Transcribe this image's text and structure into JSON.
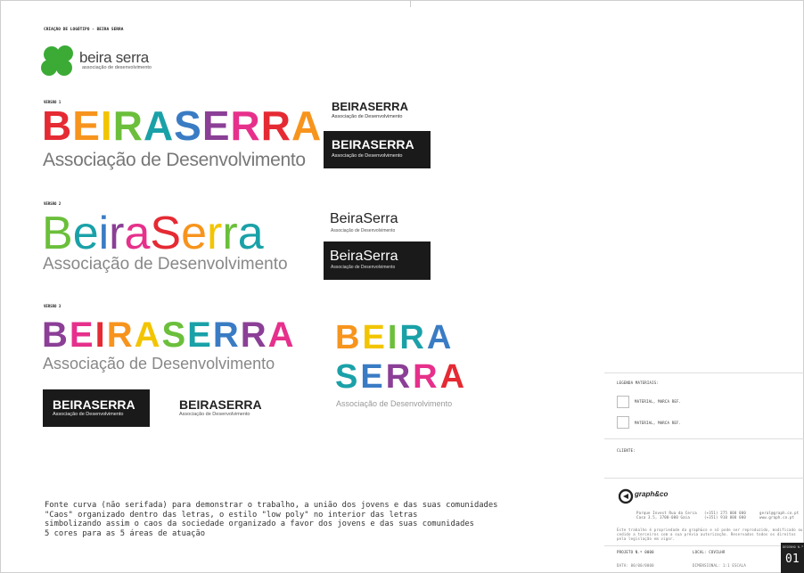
{
  "header": {
    "title": "CRIAÇÃO DE LOGÓTIPO - BEIRA SERRA",
    "logo_name": "beira serra",
    "logo_subtitle": "associação de desenvolvimento",
    "clover_color": "#3bab36"
  },
  "palette": [
    "#e52a33",
    "#f7941d",
    "#f2c500",
    "#6bbf3b",
    "#1aa1a8",
    "#3a7cc4",
    "#8b3f96",
    "#e6308b"
  ],
  "version1": {
    "label": "VERSÃO 1",
    "wordmark": "BEIRASERRA",
    "subtitle": "Associação de Desenvolvimento",
    "mini_wordmark": "BEIRASERRA",
    "mini_subtitle": "Associação de Desenvolvimento",
    "dark_wordmark": "BEIRASERRA",
    "dark_subtitle": "Associação de Desenvolvimento"
  },
  "version2": {
    "label": "VERSÃO 2",
    "wordmark": "BeiraSerra",
    "subtitle": "Associação de Desenvolvimento",
    "mini_wordmark": "BeiraSerra",
    "mini_subtitle": "Associação de Desenvolvimento",
    "dark_wordmark": "BeiraSerra",
    "dark_subtitle": "Associação de Desenvolvimento"
  },
  "version3": {
    "label": "VERSÃO 3",
    "wordmark": "BEIRASERRA",
    "subtitle": "Associação de Desenvolvimento",
    "dark_wordmark": "BEIRASERRA",
    "dark_subtitle": "Associação de Desenvolvimento",
    "mini_wordmark": "BEIRASERRA",
    "mini_subtitle": "Associação de Desenvolvimento",
    "stacked_line1": "BEIRA",
    "stacked_line2": "SERRA",
    "stacked_subtitle": "Associação de Desenvolvimento"
  },
  "description": [
    "Fonte curva (não serifada) para demonstrar o trabalho, a união dos jovens e das suas comunidades",
    "\"Caos\" organizado dentro das letras, o estilo \"low poly\" no interior das letras",
    "simbolizando assim o caos da sociedade organizado a favor dos jovens e das suas comunidades",
    "5 cores para as 5 áreas de atuação"
  ],
  "legend": {
    "title": "LEGENDA MATERIAIS:",
    "item1": "MATERIAL, MARCA REF.",
    "item2": "MATERIAL, MARCA REF."
  },
  "client_label": "CLIENTE:",
  "agency": {
    "name": "graph&co",
    "address": [
      "Parque Invest Rua da Cerca",
      "Casa 3.5, 3700-000 Gaia"
    ],
    "phone": [
      "(+351) 275 000 000",
      "(+351) 910 000 000"
    ],
    "contact": [
      "geral@graph.co.pt",
      "www.graph.co.pt"
    ],
    "legal": "Este trabalho é propriedade da graph&co e só pode ser reproduzido, modificado ou cedido a terceiros com a sua prévia autorização. Reservados todos os direitos pela legislação em vigor."
  },
  "footer": {
    "projeto": "PROJETO N.º 0000",
    "local": "LOCAL: COVILHÃ",
    "data": "DATA: 00/00/0000",
    "escala": "DIMENSIONAL: 1:1 ESCALA",
    "sheet_label": "DESENHO N.º",
    "sheet_number": "01"
  }
}
